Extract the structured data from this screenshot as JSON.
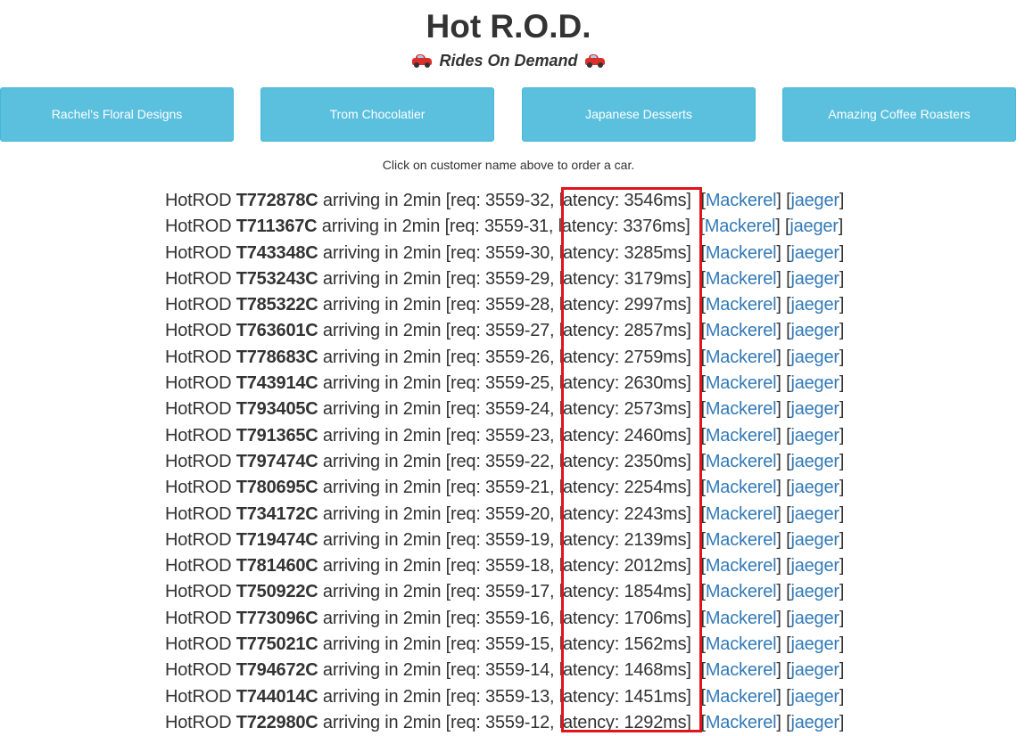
{
  "header": {
    "title": "Hot R.O.D.",
    "subtitle": "Rides On Demand"
  },
  "customers": [
    {
      "label": "Rachel's Floral Designs"
    },
    {
      "label": "Trom Chocolatier"
    },
    {
      "label": "Japanese Desserts"
    },
    {
      "label": "Amazing Coffee Roasters"
    }
  ],
  "hint": "Click on customer name above to order a car.",
  "colors": {
    "button_bg": "#5bc0de",
    "link": "#337ab7",
    "highlight_border": "#e0141b",
    "car_icon": "#d9302b"
  },
  "rides": [
    {
      "prefix": "HotROD",
      "car": "T772878C",
      "eta": "arriving in 2min",
      "req": "[req: 3559-32,",
      "latency": "latency: 3546ms]",
      "link1": "Mackerel",
      "link2": "jaeger"
    },
    {
      "prefix": "HotROD",
      "car": "T711367C",
      "eta": "arriving in 2min",
      "req": "[req: 3559-31,",
      "latency": "latency: 3376ms]",
      "link1": "Mackerel",
      "link2": "jaeger"
    },
    {
      "prefix": "HotROD",
      "car": "T743348C",
      "eta": "arriving in 2min",
      "req": "[req: 3559-30,",
      "latency": "latency: 3285ms]",
      "link1": "Mackerel",
      "link2": "jaeger"
    },
    {
      "prefix": "HotROD",
      "car": "T753243C",
      "eta": "arriving in 2min",
      "req": "[req: 3559-29,",
      "latency": "latency: 3179ms]",
      "link1": "Mackerel",
      "link2": "jaeger"
    },
    {
      "prefix": "HotROD",
      "car": "T785322C",
      "eta": "arriving in 2min",
      "req": "[req: 3559-28,",
      "latency": "latency: 2997ms]",
      "link1": "Mackerel",
      "link2": "jaeger"
    },
    {
      "prefix": "HotROD",
      "car": "T763601C",
      "eta": "arriving in 2min",
      "req": "[req: 3559-27,",
      "latency": "latency: 2857ms]",
      "link1": "Mackerel",
      "link2": "jaeger"
    },
    {
      "prefix": "HotROD",
      "car": "T778683C",
      "eta": "arriving in 2min",
      "req": "[req: 3559-26,",
      "latency": "latency: 2759ms]",
      "link1": "Mackerel",
      "link2": "jaeger"
    },
    {
      "prefix": "HotROD",
      "car": "T743914C",
      "eta": "arriving in 2min",
      "req": "[req: 3559-25,",
      "latency": "latency: 2630ms]",
      "link1": "Mackerel",
      "link2": "jaeger"
    },
    {
      "prefix": "HotROD",
      "car": "T793405C",
      "eta": "arriving in 2min",
      "req": "[req: 3559-24,",
      "latency": "latency: 2573ms]",
      "link1": "Mackerel",
      "link2": "jaeger"
    },
    {
      "prefix": "HotROD",
      "car": "T791365C",
      "eta": "arriving in 2min",
      "req": "[req: 3559-23,",
      "latency": "latency: 2460ms]",
      "link1": "Mackerel",
      "link2": "jaeger"
    },
    {
      "prefix": "HotROD",
      "car": "T797474C",
      "eta": "arriving in 2min",
      "req": "[req: 3559-22,",
      "latency": "latency: 2350ms]",
      "link1": "Mackerel",
      "link2": "jaeger"
    },
    {
      "prefix": "HotROD",
      "car": "T780695C",
      "eta": "arriving in 2min",
      "req": "[req: 3559-21,",
      "latency": "latency: 2254ms]",
      "link1": "Mackerel",
      "link2": "jaeger"
    },
    {
      "prefix": "HotROD",
      "car": "T734172C",
      "eta": "arriving in 2min",
      "req": "[req: 3559-20,",
      "latency": "latency: 2243ms]",
      "link1": "Mackerel",
      "link2": "jaeger"
    },
    {
      "prefix": "HotROD",
      "car": "T719474C",
      "eta": "arriving in 2min",
      "req": "[req: 3559-19,",
      "latency": "latency: 2139ms]",
      "link1": "Mackerel",
      "link2": "jaeger"
    },
    {
      "prefix": "HotROD",
      "car": "T781460C",
      "eta": "arriving in 2min",
      "req": "[req: 3559-18,",
      "latency": "latency: 2012ms]",
      "link1": "Mackerel",
      "link2": "jaeger"
    },
    {
      "prefix": "HotROD",
      "car": "T750922C",
      "eta": "arriving in 2min",
      "req": "[req: 3559-17,",
      "latency": "latency: 1854ms]",
      "link1": "Mackerel",
      "link2": "jaeger"
    },
    {
      "prefix": "HotROD",
      "car": "T773096C",
      "eta": "arriving in 2min",
      "req": "[req: 3559-16,",
      "latency": "latency: 1706ms]",
      "link1": "Mackerel",
      "link2": "jaeger"
    },
    {
      "prefix": "HotROD",
      "car": "T775021C",
      "eta": "arriving in 2min",
      "req": "[req: 3559-15,",
      "latency": "latency: 1562ms]",
      "link1": "Mackerel",
      "link2": "jaeger"
    },
    {
      "prefix": "HotROD",
      "car": "T794672C",
      "eta": "arriving in 2min",
      "req": "[req: 3559-14,",
      "latency": "latency: 1468ms]",
      "link1": "Mackerel",
      "link2": "jaeger"
    },
    {
      "prefix": "HotROD",
      "car": "T744014C",
      "eta": "arriving in 2min",
      "req": "[req: 3559-13,",
      "latency": "latency: 1451ms]",
      "link1": "Mackerel",
      "link2": "jaeger"
    },
    {
      "prefix": "HotROD",
      "car": "T722980C",
      "eta": "arriving in 2min",
      "req": "[req: 3559-12,",
      "latency": "latency: 1292ms]",
      "link1": "Mackerel",
      "link2": "jaeger"
    }
  ]
}
